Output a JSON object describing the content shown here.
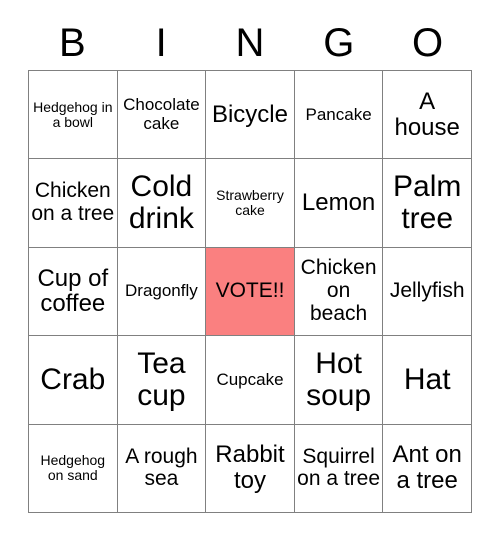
{
  "card": {
    "title_letters": [
      "B",
      "I",
      "N",
      "G",
      "O"
    ],
    "marked_color": "#fa8080",
    "grid_line_color": "#808080",
    "background_color": "#ffffff",
    "rows": [
      [
        {
          "label": "Hedgehog in a bowl",
          "size": "xs",
          "marked": false
        },
        {
          "label": "Chocolate cake",
          "size": "s",
          "marked": false
        },
        {
          "label": "Bicycle",
          "size": "l",
          "marked": false
        },
        {
          "label": "Pancake",
          "size": "s",
          "marked": false
        },
        {
          "label": "A house",
          "size": "l",
          "marked": false
        }
      ],
      [
        {
          "label": "Chicken on a tree",
          "size": "m",
          "marked": false
        },
        {
          "label": "Cold drink",
          "size": "xl",
          "marked": false
        },
        {
          "label": "Strawberry cake",
          "size": "xs",
          "marked": false
        },
        {
          "label": "Lemon",
          "size": "l",
          "marked": false
        },
        {
          "label": "Palm tree",
          "size": "xl",
          "marked": false
        }
      ],
      [
        {
          "label": "Cup of coffee",
          "size": "l",
          "marked": false
        },
        {
          "label": "Dragonfly",
          "size": "s",
          "marked": false
        },
        {
          "label": "VOTE!!",
          "size": "m",
          "marked": true
        },
        {
          "label": "Chicken on beach",
          "size": "m",
          "marked": false
        },
        {
          "label": "Jellyfish",
          "size": "m",
          "marked": false
        }
      ],
      [
        {
          "label": "Crab",
          "size": "xl",
          "marked": false
        },
        {
          "label": "Tea cup",
          "size": "xl",
          "marked": false
        },
        {
          "label": "Cupcake",
          "size": "s",
          "marked": false
        },
        {
          "label": "Hot soup",
          "size": "xl",
          "marked": false
        },
        {
          "label": "Hat",
          "size": "xl",
          "marked": false
        }
      ],
      [
        {
          "label": "Hedgehog on sand",
          "size": "xs",
          "marked": false
        },
        {
          "label": "A rough sea",
          "size": "m",
          "marked": false
        },
        {
          "label": "Rabbit toy",
          "size": "l",
          "marked": false
        },
        {
          "label": "Squirrel on a tree",
          "size": "m",
          "marked": false
        },
        {
          "label": "Ant on a tree",
          "size": "l",
          "marked": false
        }
      ]
    ]
  }
}
